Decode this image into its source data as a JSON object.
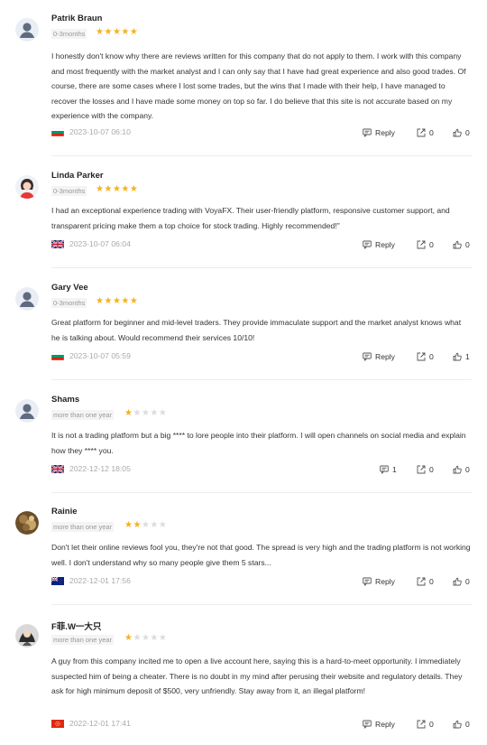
{
  "reviews": [
    {
      "name": "Patrik Braun",
      "tenure": "0-3months",
      "rating": 5,
      "text": "I honestly don't know why there are reviews written for this company that do not apply to them. I work with this company and most frequently with the market analyst and I can only say that I have had great experience and also good trades. Of course, there are some cases where I lost some trades, but the wins that I made with their help, I have managed to recover the losses and I have made some money on top so far. I do believe that this site is not accurate based on my experience with the company.",
      "flag": "bulgaria-flag",
      "datetime": "2023-10-07 06:10",
      "reply_label": "Reply",
      "share_count": "0",
      "like_count": "0",
      "avatar": "default-avatar"
    },
    {
      "name": "Linda Parker",
      "tenure": "0-3months",
      "rating": 5,
      "text": "I had an exceptional experience trading with VoyaFX. Their user-friendly platform, responsive customer support, and transparent pricing make them a top choice for stock trading. Highly recommended!\"",
      "flag": "uk-flag",
      "datetime": "2023-10-07 06:04",
      "reply_label": "Reply",
      "share_count": "0",
      "like_count": "0",
      "avatar": "female-avatar"
    },
    {
      "name": "Gary Vee",
      "tenure": "0-3months",
      "rating": 5,
      "text": "Great platform for beginner and mid-level traders. They provide immaculate support and the market analyst knows what he is talking about. Would recommend their services 10/10!",
      "flag": "bulgaria-flag",
      "datetime": "2023-10-07 05:59",
      "reply_label": "Reply",
      "share_count": "0",
      "like_count": "1",
      "avatar": "default-avatar"
    },
    {
      "name": "Shams",
      "tenure": "more than one year",
      "rating": 1,
      "text": "It is not a trading platform but a big **** to lore people into their platform. I will open channels on social media and explain how they **** you.",
      "flag": "uk-flag",
      "datetime": "2022-12-12 18:05",
      "comment_count": "1",
      "share_count": "0",
      "like_count": "0",
      "avatar": "default-avatar"
    },
    {
      "name": "Rainie",
      "tenure": "more than one year",
      "rating": 2,
      "text": "Don't let their online reviews fool you, they're not that good. The spread is very high and the trading platform is not working well. I don't understand why so many people give them 5 stars...",
      "flag": "new-zealand-flag",
      "datetime": "2022-12-01 17:56",
      "reply_label": "Reply",
      "share_count": "0",
      "like_count": "0",
      "avatar": "photo-avatar"
    },
    {
      "name": "F菲.W一大只",
      "tenure": "more than one year",
      "rating": 1,
      "text": "A guy from this company incited me to open a live account here, saying this is a hard-to-meet opportunity. I immediately suspected him of being a cheater. There is no doubt in my mind after perusing their website and regulatory details. They ask for high minimum deposit of $500, very unfriendly. Stay away from it, an illegal platform!",
      "flag": "hong-kong-flag",
      "datetime": "2022-12-01 17:41",
      "reply_label": "Reply",
      "share_count": "0",
      "like_count": "0",
      "avatar": "photo-avatar-dark"
    }
  ],
  "colors": {
    "star_filled": "#f6b11e",
    "star_empty": "#dcdcdc",
    "muted_text": "#aaaaaa",
    "divider": "#ececec"
  }
}
